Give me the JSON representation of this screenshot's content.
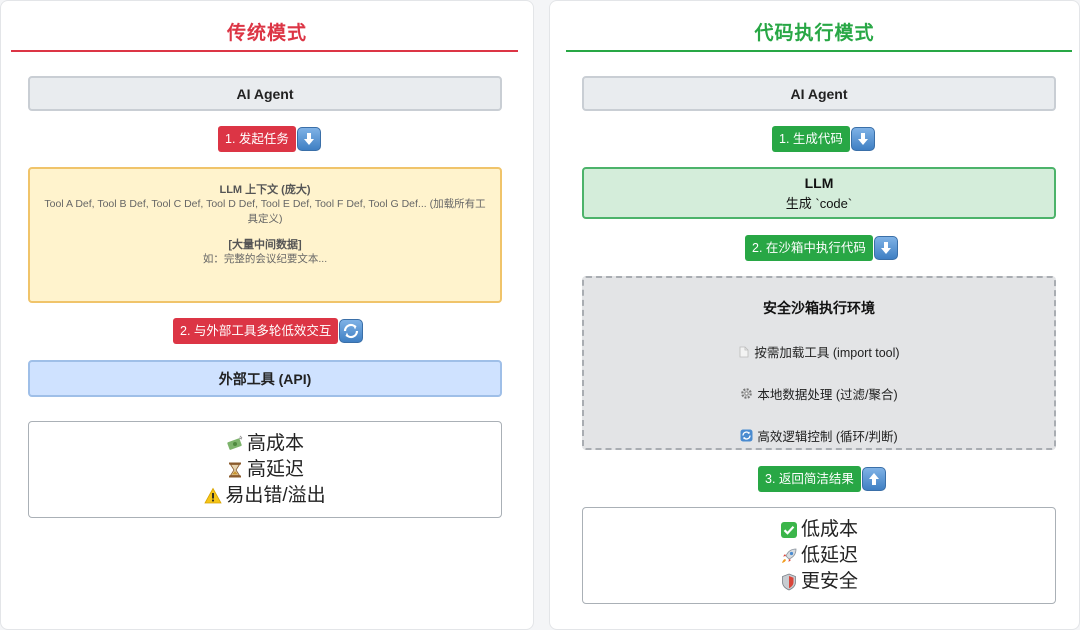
{
  "left": {
    "title": "传统模式",
    "title_color": "#dc3545",
    "agent": "AI Agent",
    "step1": "1. 发起任务",
    "context_title": "LLM 上下文 (庞大)",
    "context_text": "Tool A Def, Tool B Def, Tool C Def, Tool D Def, Tool E Def, Tool F Def, Tool G Def... (加载所有工具定义)",
    "data_title": "[大量中间数据]",
    "data_text": "如：完整的会议纪要文本...",
    "step2": "2. 与外部工具多轮低效交互",
    "tools": "外部工具 (API)",
    "results": [
      "高成本",
      "高延迟",
      "易出错/溢出"
    ],
    "result_icons": [
      "money-icon",
      "hourglass-icon",
      "warning-icon"
    ]
  },
  "right": {
    "title": "代码执行模式",
    "title_color": "#28a745",
    "agent": "AI Agent",
    "step1": "1. 生成代码",
    "llm_title": "LLM",
    "llm_sub": "生成 `code`",
    "step2": "2. 在沙箱中执行代码",
    "sandbox_title": "安全沙箱执行环境",
    "sandbox_items": [
      "按需加载工具 (import tool)",
      "本地数据处理 (过滤/聚合)",
      "高效逻辑控制 (循环/判断)"
    ],
    "sandbox_icons": [
      "document-icon",
      "gear-icon",
      "loop-icon"
    ],
    "step3": "3. 返回简洁结果",
    "results": [
      "低成本",
      "低延迟",
      "更安全"
    ],
    "result_icons": [
      "check-icon",
      "rocket-icon",
      "shield-icon"
    ]
  }
}
